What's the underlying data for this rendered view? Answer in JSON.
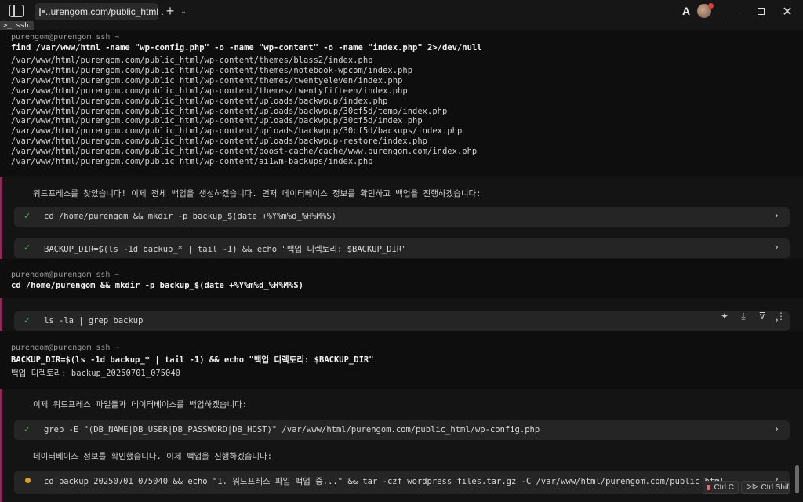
{
  "titlebar": {
    "tab_title": "..urengom.com/public_html .",
    "new_tab_glyph": "+",
    "tab_menu_glyph": "⌄",
    "ai_glyph": "A",
    "minimize_glyph": "—",
    "close_glyph": "✕"
  },
  "session_label": ">_ ssh",
  "blocks": [
    {
      "prompt": "purengom@purengom ssh ~",
      "command": "find /var/www/html -name \"wp-config.php\" -o -name \"wp-content\" -o -name \"index.php\" 2>/dev/null",
      "output": [
        "/var/www/html/purengom.com/public_html/wp-content/themes/blass2/index.php",
        "/var/www/html/purengom.com/public_html/wp-content/themes/notebook-wpcom/index.php",
        "/var/www/html/purengom.com/public_html/wp-content/themes/twentyeleven/index.php",
        "/var/www/html/purengom.com/public_html/wp-content/themes/twentyfifteen/index.php",
        "/var/www/html/purengom.com/public_html/wp-content/uploads/backwpup/index.php",
        "/var/www/html/purengom.com/public_html/wp-content/uploads/backwpup/30cf5d/temp/index.php",
        "/var/www/html/purengom.com/public_html/wp-content/uploads/backwpup/30cf5d/index.php",
        "/var/www/html/purengom.com/public_html/wp-content/uploads/backwpup/30cf5d/backups/index.php",
        "/var/www/html/purengom.com/public_html/wp-content/uploads/backwpup-restore/index.php",
        "/var/www/html/purengom.com/public_html/wp-content/boost-cache/cache/www.purengom.com/index.php",
        "/var/www/html/purengom.com/public_html/wp-content/ai1wm-backups/index.php"
      ]
    },
    {
      "prompt": "purengom@purengom ssh ~",
      "command": "cd /home/purengom && mkdir -p backup_$(date +%Y%m%d_%H%M%S)"
    },
    {
      "prompt": "purengom@purengom ssh ~",
      "command": "BACKUP_DIR=$(ls -1d backup_* | tail -1) && echo \"백업 디렉토리: $BACKUP_DIR\"",
      "output_line": "백업 디렉토리: backup_20250701_075040"
    }
  ],
  "ai": {
    "message1": "워드프레스를 찾았습니다! 이제 전체 백업을 생성하겠습니다. 먼저 데이터베이스 정보를 확인하고 백업을 진행하겠습니다:",
    "message2": "이제 워드프레스 파일들과 데이터베이스를 백업하겠습니다:",
    "message3": "데이터베이스 정보를 확인했습니다. 이제 백업을 진행하겠습니다:",
    "check_glyph": "✓",
    "chevron_glyph": "›"
  },
  "steps": [
    {
      "status": "done",
      "text": "cd /home/purengom && mkdir -p backup_$(date +%Y%m%d_%H%M%S)"
    },
    {
      "status": "done",
      "text": "BACKUP_DIR=$(ls -1d backup_* | tail -1) && echo \"백업 디렉토리: $BACKUP_DIR\""
    },
    {
      "status": "done",
      "text": "ls -la | grep backup"
    },
    {
      "status": "done",
      "text": "grep -E \"(DB_NAME|DB_USER|DB_PASSWORD|DB_HOST)\" /var/www/html/purengom.com/public_html/wp-config.php"
    },
    {
      "status": "running",
      "text": "cd backup_20250701_075040 && echo \"1. 워드프레스 파일 백업 중...\" && tar -czf wordpress_files.tar.gz -C /var/www/html/purengom.com/public_html"
    }
  ],
  "block_actions": {
    "pin_glyph": "✦",
    "download_glyph": "⤓",
    "filter_glyph": "⊽",
    "more_glyph": "⋮"
  },
  "hints": {
    "stop": "Ctrl C",
    "run_prefix": "ᐅᐅ",
    "run": "Ctrl Shift I"
  },
  "colors": {
    "ai_bar": "#8f2b57",
    "success": "#3fae5f",
    "running": "#e3a21a",
    "stop": "#e36a6a"
  }
}
